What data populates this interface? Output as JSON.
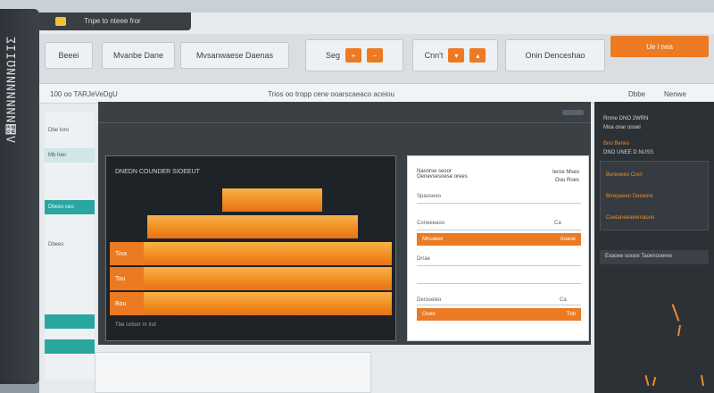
{
  "app": {
    "side_title": "Λ΢ΝΝΝΝΝΝΝΩΙΙΣ",
    "window_title": "Tnpe to nteee fror"
  },
  "toolbar": {
    "btn1": "Beeei",
    "btn2": "Mvanbe Dane",
    "btn3": "Mvsanwaese Daenas",
    "btn4_label": "Seg",
    "btn5_label": "Cnn't",
    "btn6": "Onin Denceshao",
    "primary": "Ue i nea"
  },
  "subheader": {
    "left": "100 oo TARJeVeDgU",
    "center": "Trios oo tropp cerw ooarscaeaco aceiou",
    "right1": "Dbbe",
    "right2": "Nenwe"
  },
  "nav": {
    "items": [
      "Dbe Ioro",
      "Mb Ioer",
      "Dbees ceo",
      "Dbees"
    ]
  },
  "chart": {
    "title": "DNEDN COUNDER SIOEEUT",
    "footer": "Tbe cotoer nr Ind",
    "rows": [
      "Tixa",
      "Tou",
      "Bou"
    ]
  },
  "chart_data": {
    "type": "bar",
    "categories": [
      "",
      "",
      "Tixa",
      "Tou",
      "Bou"
    ],
    "values": [
      59,
      86,
      100,
      100,
      100
    ],
    "title": "DNEDN COUNDER SIOEEUT",
    "xlabel": "",
    "ylabel": "",
    "xlim": [
      0,
      100
    ]
  },
  "form": {
    "title": "Nasnrse seoor",
    "subtitle": "Oenevsesoese orees",
    "right_top": "Ieroe Mseo",
    "right_top2": "Ouu Roes",
    "label1": "Spaoseeo",
    "label2": "Coneeeaoo",
    "bar1_left": "Mnuaeer",
    "bar1_right": "Aoaoe",
    "label3": "Drrae",
    "label4": "Deroseieo",
    "bar2_left": "Ooee",
    "bar2_right": "Tbb",
    "c1": "Ca",
    "c2": "Ca"
  },
  "right_panel": {
    "t1": "Rnme DNO 2WRN",
    "t2": "Moa onar oooel",
    "t3": "Bno Benes",
    "t4": "DNO UNEE D NUSS",
    "box_lines": [
      "Bureoeeo Cren",
      "Brrepaeen Deeeore",
      "Coetaneeaeemaone"
    ],
    "t5": "Exaoee ooooe Taoenoseree"
  },
  "colors": {
    "accent": "#ec7a22",
    "teal": "#2aa6a0",
    "dark": "#3b4045"
  }
}
